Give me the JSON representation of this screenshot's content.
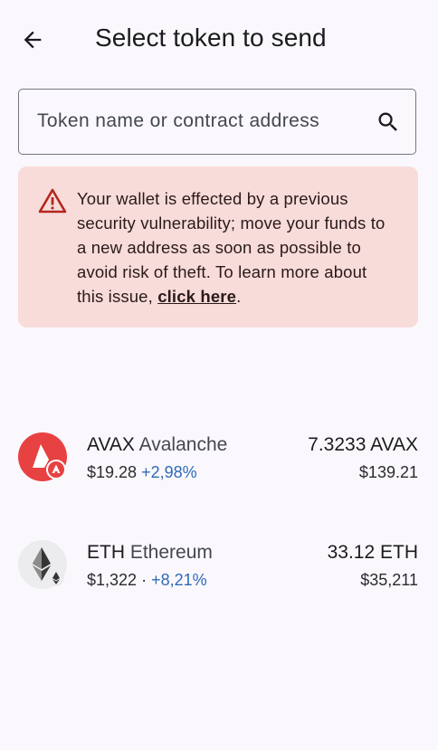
{
  "header": {
    "title": "Select token to send",
    "back_icon": "arrow-left-icon"
  },
  "search": {
    "placeholder": "Token name or contract address",
    "value": "",
    "icon": "search-icon"
  },
  "warning": {
    "icon": "warning-triangle-icon",
    "text": "Your wallet is effected by a previous security vulnerability; move your funds to a new address as soon as possible to avoid risk of theft. To learn more about this issue, ",
    "link_label": "click here",
    "suffix": ".",
    "background_color": "#f8dcda",
    "icon_color": "#b3261e"
  },
  "tokens": [
    {
      "symbol": "AVAX",
      "name": "Avalanche",
      "price": "$19.28",
      "separator": "",
      "change": "+2,98%",
      "balance": "7.3233 AVAX",
      "value": "$139.21",
      "icon": "avalanche-logo-icon",
      "brand_color": "#e84142"
    },
    {
      "symbol": "ETH",
      "name": "Ethereum",
      "price": "$1,322",
      "separator": "·",
      "change": "+8,21%",
      "balance": "33.12 ETH",
      "value": "$35,211",
      "icon": "ethereum-logo-icon",
      "brand_color": "#343434"
    }
  ],
  "colors": {
    "background": "#fbf8fd",
    "positive_change": "#2e6bb5"
  }
}
